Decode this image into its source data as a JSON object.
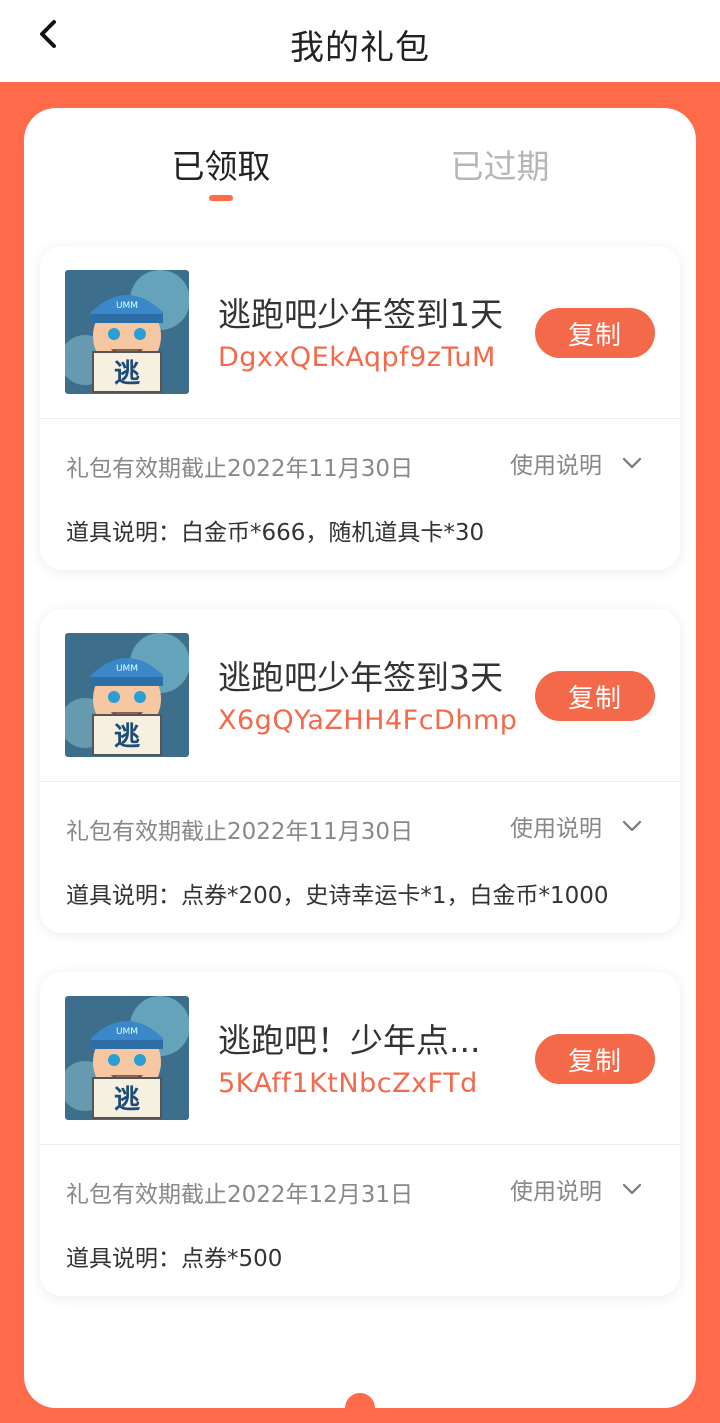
{
  "header": {
    "title": "我的礼包",
    "back_icon": "chevron-left-icon"
  },
  "tabs": [
    {
      "label": "已领取",
      "active": true
    },
    {
      "label": "已过期",
      "active": false
    }
  ],
  "colors": {
    "accent": "#ff6a4b",
    "code_text": "#f4694a",
    "inactive_tab": "#b6b6b6"
  },
  "cards": [
    {
      "name": "逃跑吧少年签到1天",
      "code": "DgxxQEkAqpf9zTuM",
      "copy_label": "复制",
      "expiry": "礼包有效期截止2022年11月30日",
      "usage_label": "使用说明",
      "items": "道具说明：白金币*666，随机道具卡*30",
      "thumb_char": "逃",
      "thumb_hat_text": "UMM"
    },
    {
      "name": "逃跑吧少年签到3天",
      "code": "X6gQYaZHH4FcDhmp",
      "copy_label": "复制",
      "expiry": "礼包有效期截止2022年11月30日",
      "usage_label": "使用说明",
      "items": "道具说明：点券*200，史诗幸运卡*1，白金币*1000",
      "thumb_char": "逃",
      "thumb_hat_text": "UMM"
    },
    {
      "name": "逃跑吧！少年点...",
      "code": "5KAff1KtNbcZxFTd",
      "copy_label": "复制",
      "expiry": "礼包有效期截止2022年12月31日",
      "usage_label": "使用说明",
      "items": "道具说明：点券*500",
      "thumb_char": "逃",
      "thumb_hat_text": "UMM"
    }
  ]
}
